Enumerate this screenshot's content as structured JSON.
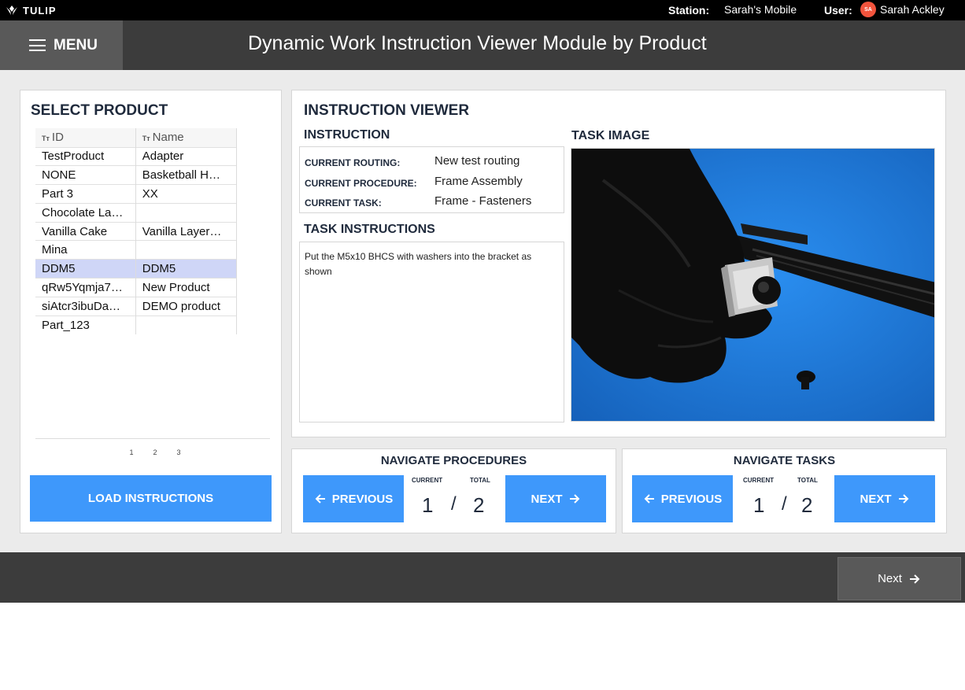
{
  "topbar": {
    "brand": "TULIP",
    "station_label": "Station:",
    "station_value": "Sarah's Mobile",
    "user_label": "User:",
    "user_initials": "SA",
    "user_value": "Sarah Ackley"
  },
  "header": {
    "menu_label": "MENU",
    "title": "Dynamic Work Instruction Viewer Module by Product"
  },
  "product_panel": {
    "title": "SELECT PRODUCT",
    "columns": {
      "id": "ID",
      "name": "Name",
      "type_glyph": "Tт"
    },
    "rows": [
      {
        "id": "TestProduct",
        "name": "Adapter"
      },
      {
        "id": "NONE",
        "name": "Basketball H…"
      },
      {
        "id": "Part 3",
        "name": "XX"
      },
      {
        "id": "Chocolate La…",
        "name": ""
      },
      {
        "id": "Vanilla Cake",
        "name": "Vanilla Layer…"
      },
      {
        "id": "Mina",
        "name": ""
      },
      {
        "id": "DDM5",
        "name": "DDM5"
      },
      {
        "id": "qRw5Yqmja7…",
        "name": "New Product"
      },
      {
        "id": "siAtcr3ibuDa…",
        "name": "DEMO product"
      },
      {
        "id": "Part_123",
        "name": ""
      }
    ],
    "selected_row": 6,
    "pages": [
      "1",
      "2",
      "3"
    ],
    "load_button": "LOAD INSTRUCTIONS"
  },
  "viewer": {
    "title": "INSTRUCTION VIEWER",
    "instruction_title": "INSTRUCTION",
    "routing_label": "CURRENT ROUTING:",
    "routing_value": "New test routing",
    "procedure_label": "CURRENT PROCEDURE:",
    "procedure_value": "Frame Assembly",
    "task_label": "CURRENT TASK:",
    "task_value": "Frame - Fasteners",
    "task_instructions_title": "TASK INSTRUCTIONS",
    "task_instructions": "Put the M5x10 BHCS with washers into the bracket as shown",
    "task_image_title": "TASK IMAGE"
  },
  "nav_procedures": {
    "title": "NAVIGATE PROCEDURES",
    "previous": "PREVIOUS",
    "next": "NEXT",
    "current_label": "CURRENT",
    "total_label": "TOTAL",
    "current": "1",
    "separator": "/",
    "total": "2"
  },
  "nav_tasks": {
    "title": "NAVIGATE TASKS",
    "previous": "PREVIOUS",
    "next": "NEXT",
    "current_label": "CURRENT",
    "total_label": "TOTAL",
    "current": "1",
    "separator": "/",
    "total": "2"
  },
  "footer": {
    "next_label": "Next"
  },
  "colors": {
    "accent": "#3e98fb",
    "selected_row": "#cfd6f7",
    "avatar": "#f2543d"
  },
  "icons": [
    "tulip-logo-icon",
    "hamburger-icon",
    "arrow-left-icon",
    "arrow-right-icon"
  ]
}
